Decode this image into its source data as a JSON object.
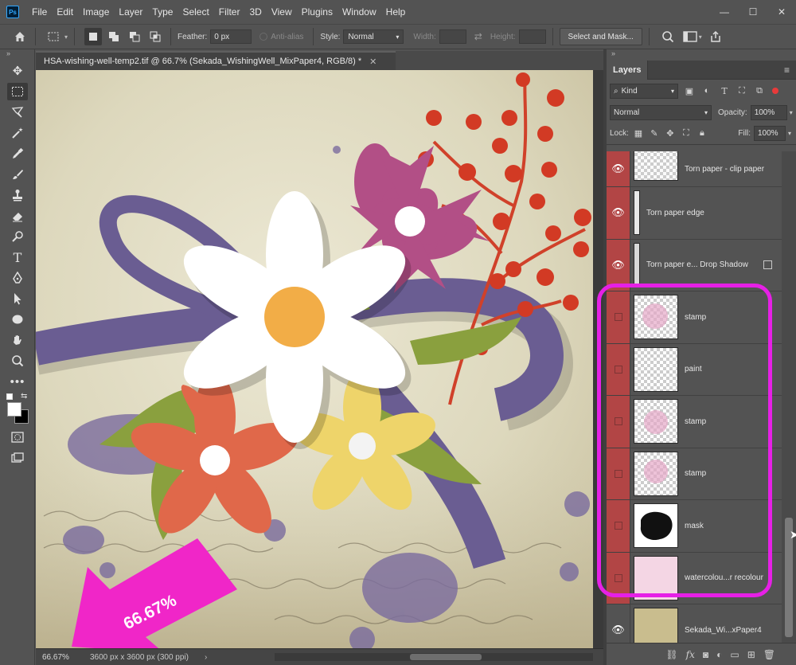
{
  "app": {
    "logo": "Ps"
  },
  "menu": [
    "File",
    "Edit",
    "Image",
    "Layer",
    "Type",
    "Select",
    "Filter",
    "3D",
    "View",
    "Plugins",
    "Window",
    "Help"
  ],
  "window_controls": [
    "—",
    "☐",
    "✕"
  ],
  "options": {
    "feather_label": "Feather:",
    "feather_value": "0 px",
    "antialias_label": "Anti-alias",
    "style_label": "Style:",
    "style_value": "Normal",
    "width_label": "Width:",
    "height_label": "Height:",
    "select_mask_label": "Select and Mask..."
  },
  "document": {
    "tab_title": "HSA-wishing-well-temp2.tif @ 66.7% (Sekada_WishingWell_MixPaper4, RGB/8) *",
    "close": "✕"
  },
  "status": {
    "zoom": "66.67%",
    "info": "3600 px x 3600 px (300 ppi)",
    "arrow": "›"
  },
  "callout": {
    "zoom_text": "66.67%",
    "color": "#f026c8"
  },
  "layers_panel": {
    "title": "Layers",
    "filter_kind": "Kind",
    "blend_mode": "Normal",
    "opacity_label": "Opacity:",
    "opacity_value": "100%",
    "lock_label": "Lock:",
    "fill_label": "Fill:",
    "fill_value": "100%",
    "layers": [
      {
        "name": "Torn paper - clip paper",
        "visible": true
      },
      {
        "name": "Torn paper edge",
        "visible": true
      },
      {
        "name": "Torn paper e... Drop Shadow",
        "visible": true
      },
      {
        "name": "stamp",
        "visible": false
      },
      {
        "name": "paint",
        "visible": false
      },
      {
        "name": "stamp",
        "visible": false
      },
      {
        "name": "stamp",
        "visible": false
      },
      {
        "name": "mask",
        "visible": false
      },
      {
        "name": "watercolou...r recolour",
        "visible": false
      },
      {
        "name": "Sekada_Wi...xPaper4",
        "visible": true
      }
    ]
  },
  "colors": {
    "layer_red": "#b24545",
    "highlight": "#e620e6",
    "panel_bg": "#535353"
  }
}
